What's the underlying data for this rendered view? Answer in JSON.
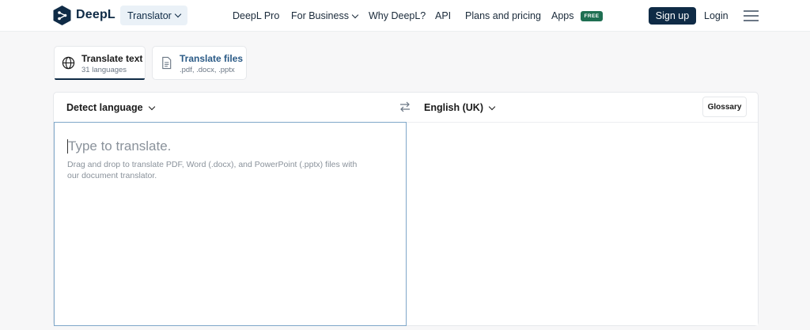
{
  "header": {
    "brand": "DeepL",
    "product_dropdown": "Translator",
    "nav": [
      "DeepL Pro",
      "For Business",
      "Why DeepL?",
      "API",
      "Plans and pricing",
      "Apps"
    ],
    "apps_badge": "FREE",
    "signup": "Sign up",
    "login": "Login",
    "icons": [
      "deepl-logo-icon",
      "chevron-down-icon",
      "hamburger-menu-icon"
    ]
  },
  "modes": {
    "text": {
      "title": "Translate text",
      "subtitle": "31 languages",
      "icon": "globe-icon"
    },
    "files": {
      "title": "Translate files",
      "subtitle": ".pdf, .docx, .pptx",
      "icon": "document-icon"
    }
  },
  "translator": {
    "source_language": "Detect language",
    "target_language": "English (UK)",
    "glossary_label": "Glossary",
    "swap_icon": "swap-arrows-icon",
    "source_placeholder": "Type to translate.",
    "source_hint": "Drag and drop to translate PDF, Word (.docx), and PowerPoint (.pptx) files with our document translator."
  },
  "colors": {
    "brand_navy": "#0f2b46",
    "dropdown_bg": "#eaf1f7",
    "free_badge": "#1f6f52",
    "focus_border": "#7fa7c9",
    "page_bg": "#f7f7f8"
  }
}
